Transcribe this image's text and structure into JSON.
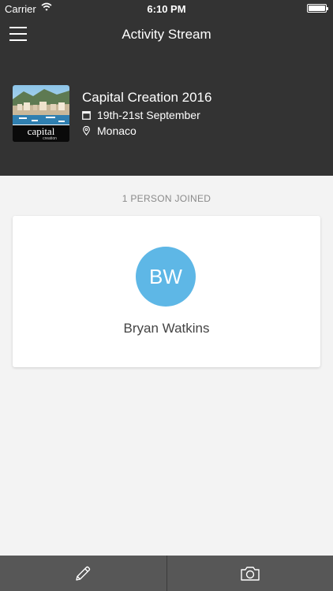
{
  "status_bar": {
    "carrier": "Carrier",
    "time": "6:10 PM",
    "battery_level": 1.0
  },
  "header": {
    "title": "Activity Stream",
    "menu_icon": "hamburger-menu-icon"
  },
  "event": {
    "title": "Capital Creation 2016",
    "date": "19th-21st September",
    "location": "Monaco",
    "date_icon": "calendar-icon",
    "location_icon": "map-pin-icon",
    "thumbnail_brand_text": "capital",
    "thumbnail_brand_sub": "creation"
  },
  "attendees": {
    "count_label": "1 PERSON JOINED",
    "people": [
      {
        "initials": "BW",
        "name": "Bryan Watkins",
        "avatar_color": "#5eb7e6"
      }
    ]
  },
  "tab_bar": {
    "items": [
      {
        "icon": "pencil-icon"
      },
      {
        "icon": "camera-icon"
      }
    ]
  },
  "colors": {
    "header_bg": "#333333",
    "body_bg": "#f3f3f3",
    "tab_bar_bg": "#575757",
    "avatar": "#5eb7e6"
  }
}
